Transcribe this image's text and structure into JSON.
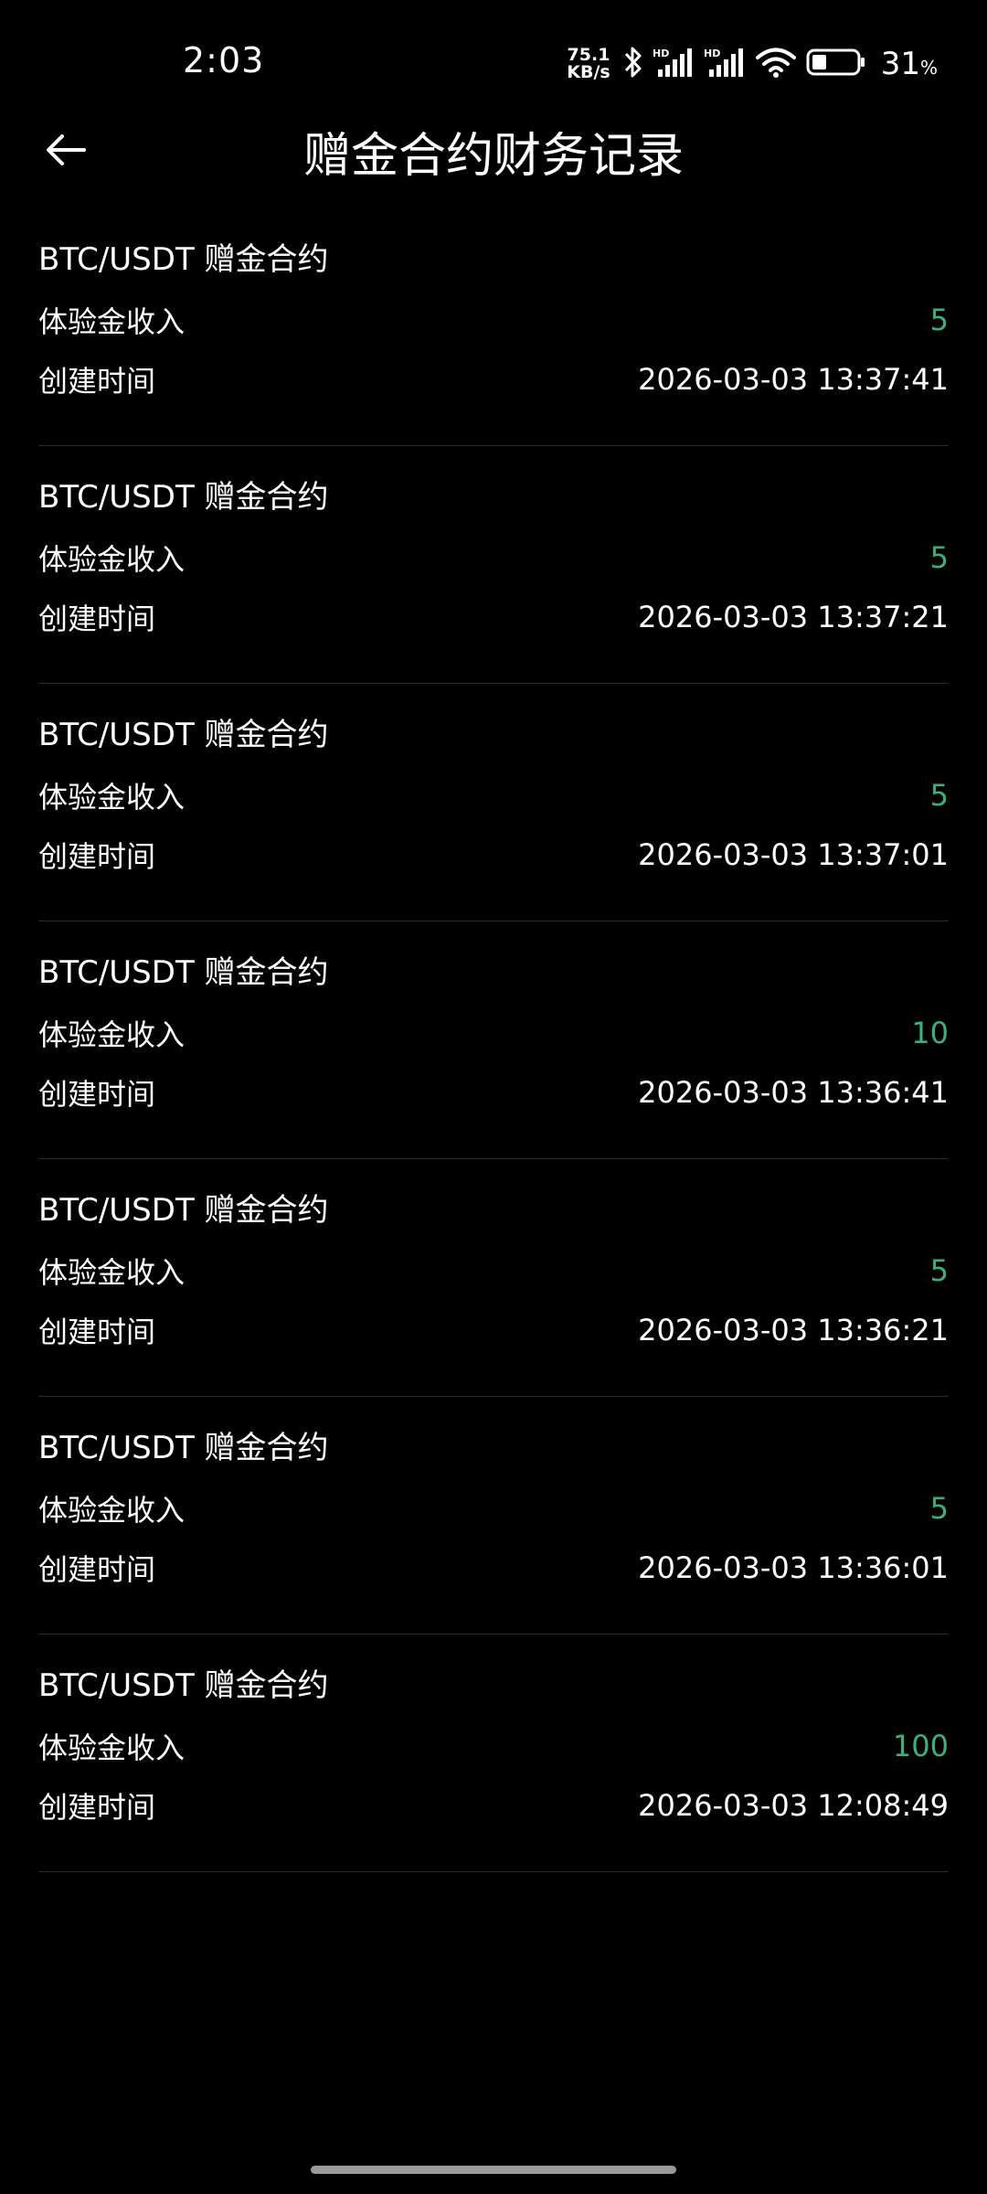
{
  "status_bar": {
    "time": "2:03",
    "net_speed_value": "75.1",
    "net_speed_unit": "KB/s",
    "battery_percent": "31",
    "battery_unit": "%",
    "signal_1_label": "HD",
    "signal_2_label": "HD",
    "icons": [
      "bluetooth-icon",
      "signal-icon",
      "signal-icon",
      "wifi-icon",
      "battery-icon"
    ]
  },
  "header": {
    "title": "赠金合约财务记录",
    "back_icon": "back-arrow-icon"
  },
  "colors": {
    "background": "#000000",
    "text": "#ffffff",
    "amount_green": "#3ab07a",
    "divider": "#2a2a2a"
  },
  "records": [
    {
      "title": "BTC/USDT 赠金合约",
      "amount_label": "体验金收入",
      "amount": "5",
      "time_label": "创建时间",
      "time": "2026-03-03 13:37:41"
    },
    {
      "title": "BTC/USDT 赠金合约",
      "amount_label": "体验金收入",
      "amount": "5",
      "time_label": "创建时间",
      "time": "2026-03-03 13:37:21"
    },
    {
      "title": "BTC/USDT 赠金合约",
      "amount_label": "体验金收入",
      "amount": "5",
      "time_label": "创建时间",
      "time": "2026-03-03 13:37:01"
    },
    {
      "title": "BTC/USDT 赠金合约",
      "amount_label": "体验金收入",
      "amount": "10",
      "time_label": "创建时间",
      "time": "2026-03-03 13:36:41"
    },
    {
      "title": "BTC/USDT 赠金合约",
      "amount_label": "体验金收入",
      "amount": "5",
      "time_label": "创建时间",
      "time": "2026-03-03 13:36:21"
    },
    {
      "title": "BTC/USDT 赠金合约",
      "amount_label": "体验金收入",
      "amount": "5",
      "time_label": "创建时间",
      "time": "2026-03-03 13:36:01"
    },
    {
      "title": "BTC/USDT 赠金合约",
      "amount_label": "体验金收入",
      "amount": "100",
      "time_label": "创建时间",
      "time": "2026-03-03 12:08:49"
    }
  ]
}
